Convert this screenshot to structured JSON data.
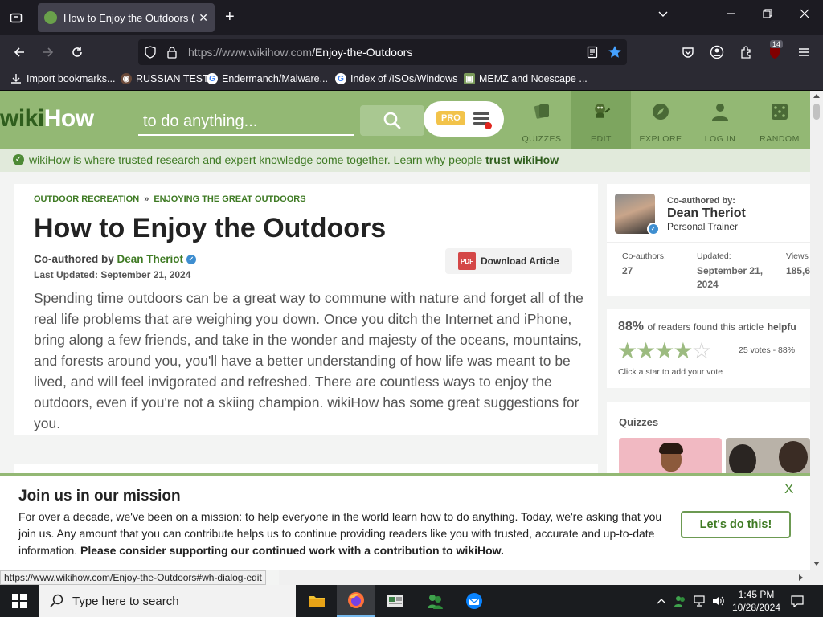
{
  "browser": {
    "tab_title": "How to Enjoy the Outdoors (wit",
    "url_host": "https://www.wikihow.com",
    "url_path": "/Enjoy-the-Outdoors",
    "extension_badge": "14",
    "bookmarks": [
      {
        "label": "Import bookmarks...",
        "icon": "import-icon"
      },
      {
        "label": "RUSSIAN TEST",
        "icon": "generic-site-icon"
      },
      {
        "label": "Endermanch/Malware...",
        "icon": "google-icon"
      },
      {
        "label": "Index of /ISOs/Windows",
        "icon": "google-icon"
      },
      {
        "label": "MEMZ and Noescape ...",
        "icon": "image-icon"
      }
    ],
    "status_url": "https://www.wikihow.com/Enjoy-the-Outdoors#wh-dialog-edit"
  },
  "header": {
    "logo_wiki": "wiki",
    "logo_how": "How",
    "search_placeholder": "to do anything...",
    "pro_label": "PRO",
    "nav": [
      {
        "label": "QUIZZES",
        "icon": "quiz-cards-icon"
      },
      {
        "label": "EDIT",
        "icon": "edit-avatar-icon"
      },
      {
        "label": "EXPLORE",
        "icon": "compass-icon"
      },
      {
        "label": "LOG IN",
        "icon": "user-icon"
      },
      {
        "label": "RANDOM",
        "icon": "dice-icon"
      }
    ]
  },
  "trust_bar": {
    "text": "wikiHow is where trusted research and expert knowledge come together. Learn why people ",
    "bold": "trust wikiHow"
  },
  "article": {
    "breadcrumb_1": "OUTDOOR RECREATION",
    "breadcrumb_sep": "»",
    "breadcrumb_2": "ENJOYING THE GREAT OUTDOORS",
    "title": "How to Enjoy the Outdoors",
    "coauthored_prefix": "Co-authored by",
    "author": "Dean Theriot",
    "last_updated": "Last Updated: September 21, 2024",
    "download_label": "Download Article",
    "pdf_label": "PDF",
    "intro": "Spending time outdoors can be a great way to commune with nature and forget all of the real life problems that are weighing you down. Once you ditch the Internet and iPhone, bring along a few friends, and take in the wonder and majesty of the oceans, mountains, and forests around you, you'll have a better understanding of how life was meant to be lived, and will feel invigorated and refreshed. There are countless ways to enjoy the outdoors, even if you're not a skiing champion. wikiHow has some great suggestions for you."
  },
  "sidebar": {
    "coauthored_label": "Co-authored by:",
    "author_name": "Dean Theriot",
    "author_role": "Personal Trainer",
    "stats": [
      {
        "label": "Co-authors:",
        "value": "27"
      },
      {
        "label": "Updated:",
        "value": "September 21, 2024"
      },
      {
        "label": "Views",
        "value": "185,6"
      }
    ],
    "rating_pct": "88%",
    "rating_text": "of readers found this article",
    "rating_bold": "helpfu",
    "stars_value": 4.5,
    "votes": "25 votes - 88%",
    "click_star": "Click a star to add your vote",
    "quizzes_heading": "Quizzes"
  },
  "mission": {
    "title": "Join us in our mission",
    "body": "For over a decade, we've been on a mission: to help everyone in the world learn how to do anything. Today, we're asking that you join us. Any amount that you can contribute helps us to continue providing readers like you with trusted, accurate and up-to-date information. ",
    "body_bold": "Please consider supporting our continued work with a contribution to wikiHow.",
    "close": "X",
    "button": "Let's do this!"
  },
  "taskbar": {
    "search_placeholder": "Type here to search",
    "time": "1:45 PM",
    "date": "10/28/2024"
  }
}
